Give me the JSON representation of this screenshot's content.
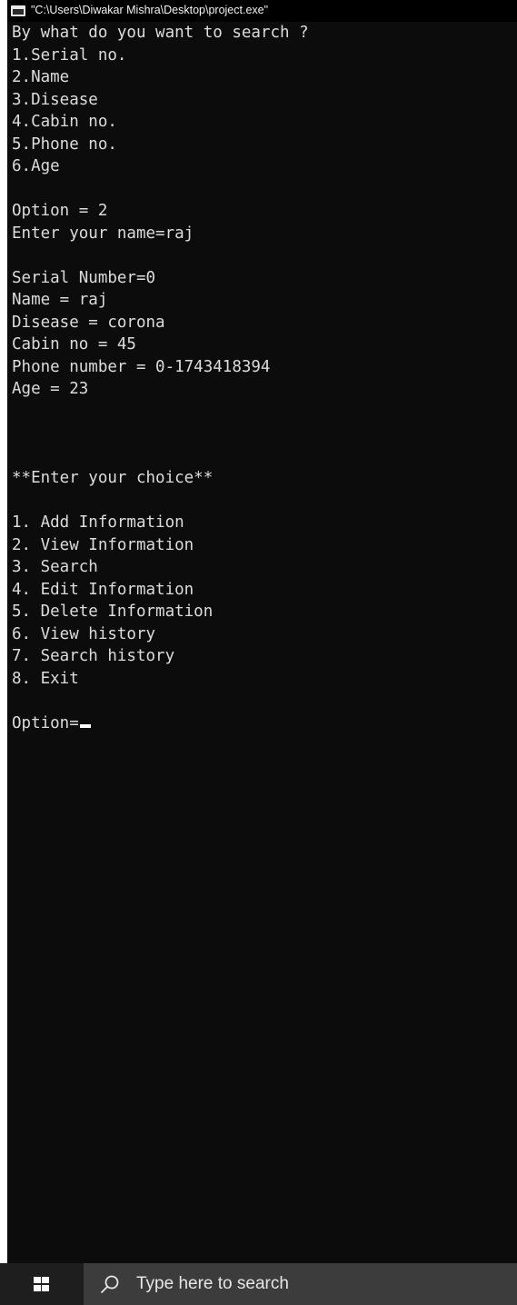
{
  "window": {
    "title": "\"C:\\Users\\Diwakar Mishra\\Desktop\\project.exe\""
  },
  "console": {
    "search_prompt": "By what do you want to search ?",
    "search_options": [
      "1.Serial no.",
      "2.Name",
      "3.Disease",
      "4.Cabin no.",
      "5.Phone no.",
      "6.Age"
    ],
    "option_selected": "Option = 2",
    "name_prompt": "Enter your name=raj",
    "record": {
      "serial": "Serial Number=0",
      "name": "Name = raj",
      "disease": "Disease = corona",
      "cabin": "Cabin no = 45",
      "phone": "Phone number = 0-1743418394",
      "age": "Age = 23"
    },
    "menu_heading": "**Enter your choice**",
    "menu_items": [
      "1. Add Information",
      "2. View Information",
      "3. Search",
      "4. Edit Information",
      "5. Delete Information",
      "6. View history",
      "7. Search history",
      "8. Exit"
    ],
    "input_prompt": "Option="
  },
  "taskbar": {
    "search_placeholder": "Type here to search",
    "start_icon": "windows-logo-icon",
    "search_icon": "search-icon"
  },
  "colors": {
    "console_background": "#0c0c0c",
    "console_text": "#dcdcdc",
    "titlebar_background": "#000000",
    "taskbar_background": "#1e1e1e",
    "search_box_background": "#3c3c3c"
  }
}
